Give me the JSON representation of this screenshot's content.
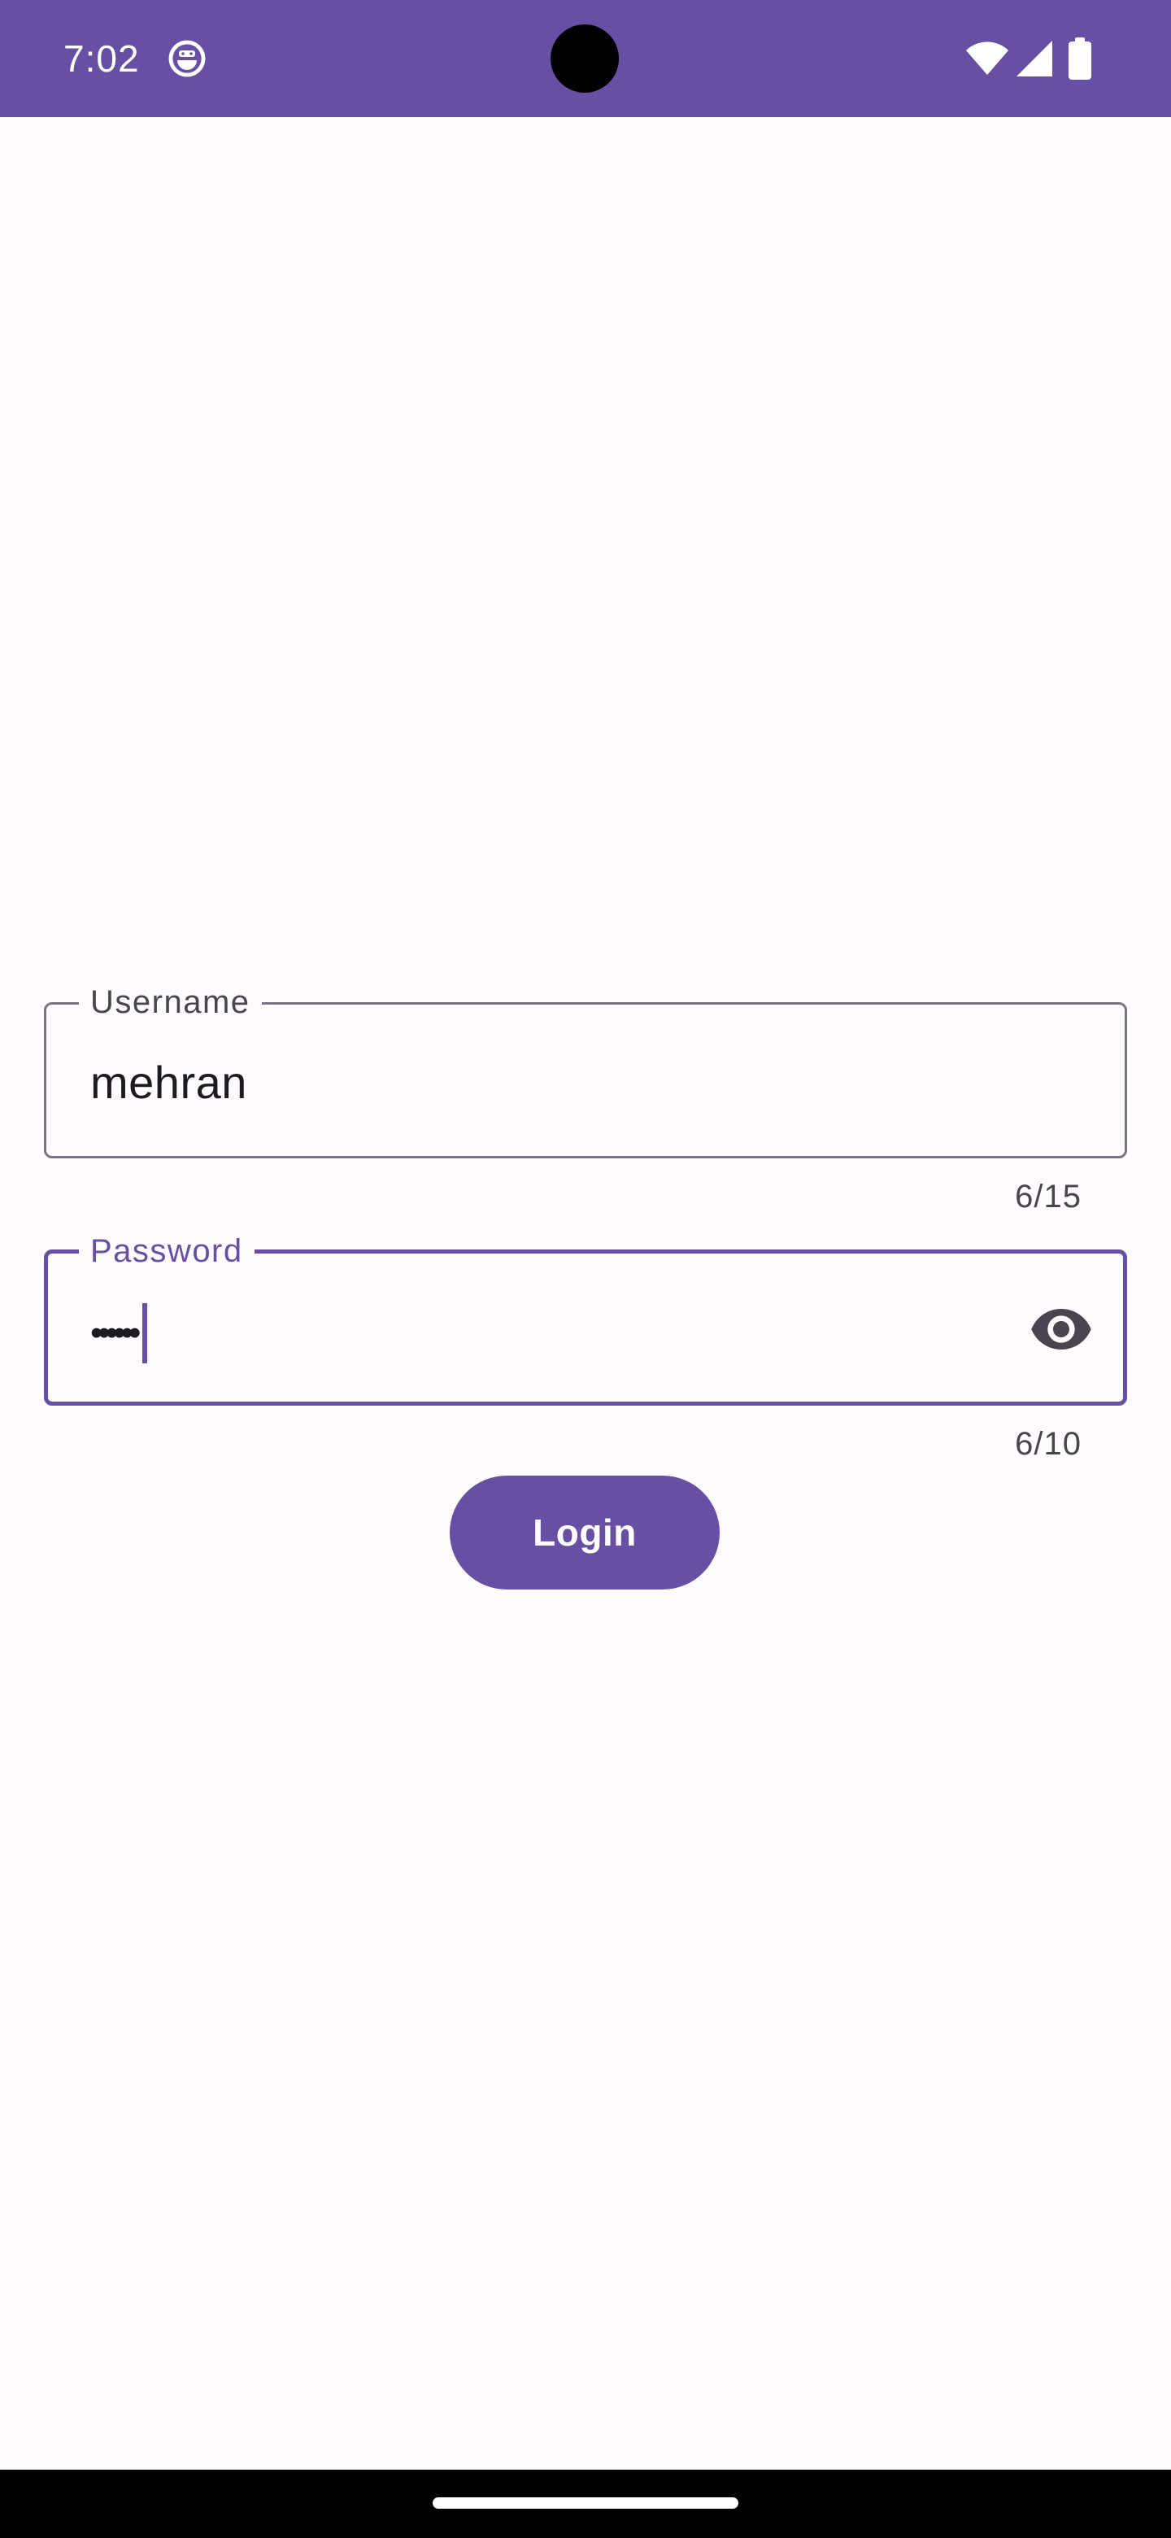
{
  "status_bar": {
    "time": "7:02",
    "background_color": "#6750A4",
    "icons": [
      "debug-icon",
      "wifi-icon",
      "signal-icon",
      "battery-icon"
    ]
  },
  "form": {
    "username": {
      "label": "Username",
      "value": "mehran",
      "counter": "6/15"
    },
    "password": {
      "label": "Password",
      "masked_value": "••••••",
      "counter": "6/10",
      "toggle_icon": "visibility-icon"
    },
    "login_button": {
      "label": "Login"
    }
  },
  "colors": {
    "primary": "#6750A4",
    "background": "#FFFBFE",
    "outline": "#79747E",
    "on_surface": "#1C1B1F"
  }
}
